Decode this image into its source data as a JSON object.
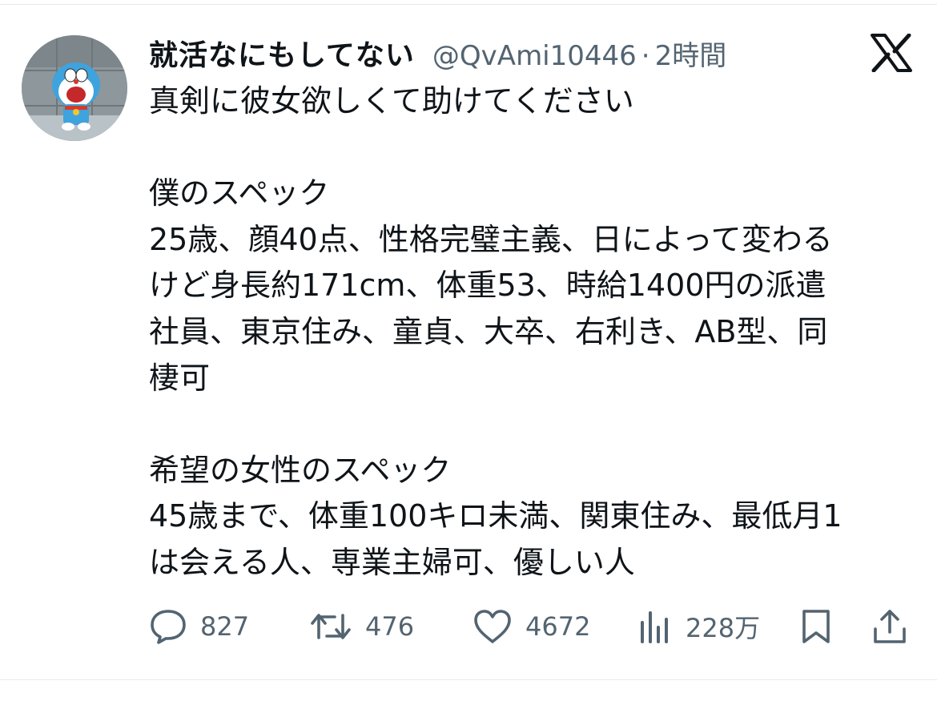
{
  "tweet": {
    "display_name": "就活なにもしてない",
    "handle": "@QvAmi10446",
    "separator": "·",
    "time": "2時間",
    "platform_logo": "x-logo",
    "avatar_description_icon": "avatar-icon",
    "lines": [
      "真剣に彼女欲しくて助けてください",
      "",
      "僕のスペック",
      "25歳、顔40点、性格完璧主義、日によって変わる",
      "けど身長約171cm、体重53、時給1400円の派遣",
      "社員、東京住み、童貞、大卒、右利き、AB型、同",
      "棲可",
      "",
      "希望の女性のスペック",
      "45歳まで、体重100キロ未満、関東住み、最低月1",
      "は会える人、専業主婦可、優しい人"
    ]
  },
  "actions": {
    "reply": {
      "icon": "reply-icon",
      "count": "827"
    },
    "repost": {
      "icon": "repost-icon",
      "count": "476"
    },
    "like": {
      "icon": "heart-icon",
      "count": "4672"
    },
    "views": {
      "icon": "views-icon",
      "count": "228万"
    },
    "bookmark": {
      "icon": "bookmark-icon"
    },
    "share": {
      "icon": "share-icon"
    }
  },
  "colors": {
    "text": "#0f1419",
    "secondary": "#536471",
    "divider": "#e6e9ec"
  }
}
